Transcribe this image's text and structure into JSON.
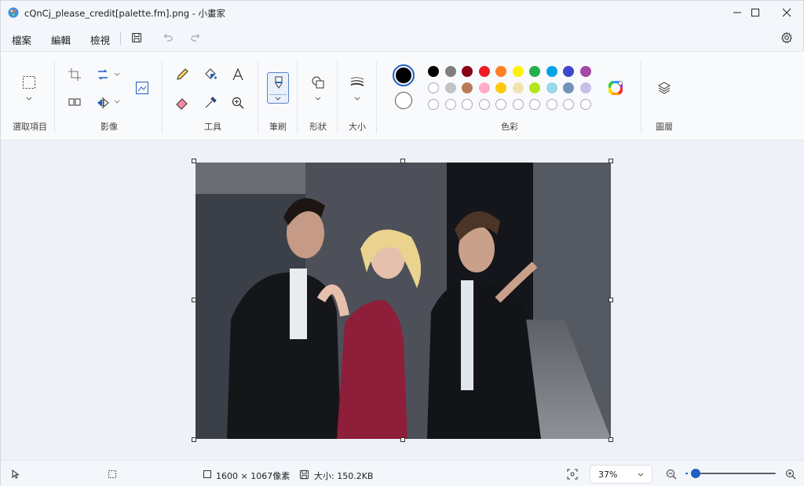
{
  "window": {
    "title": "cQnCj_please_credit[palette.fm].png - 小畫家"
  },
  "menu": {
    "file": "檔案",
    "edit": "編輯",
    "view": "檢視"
  },
  "ribbon": {
    "groups": {
      "selection": "選取項目",
      "image": "影像",
      "tools": "工具",
      "brushes": "筆刷",
      "shapes": "形狀",
      "size": "大小",
      "colors": "色彩",
      "layers": "圖層"
    },
    "primary_color": "#000000",
    "secondary_color": "#ffffff",
    "palette_row1": [
      "#000000",
      "#7f7f7f",
      "#880015",
      "#ed1c24",
      "#ff7f27",
      "#fff200",
      "#22b14c",
      "#00a2e8",
      "#3f48cc",
      "#a349a4"
    ],
    "palette_row2": [
      "#ffffff",
      "#c3c3c3",
      "#b97a57",
      "#ffaec9",
      "#ffc90e",
      "#efe4b0",
      "#b5e61d",
      "#99d9ea",
      "#7092be",
      "#c8bfe7"
    ],
    "palette_row3_empty": 10
  },
  "canvas": {
    "image_description_icon": "photo-of-three-people"
  },
  "status": {
    "dimensions": "1600 × 1067像素",
    "size": "大小: 150.2KB",
    "zoom": "37%",
    "zoom_fraction": 0.37
  },
  "accent_color": "#1f5fc4"
}
